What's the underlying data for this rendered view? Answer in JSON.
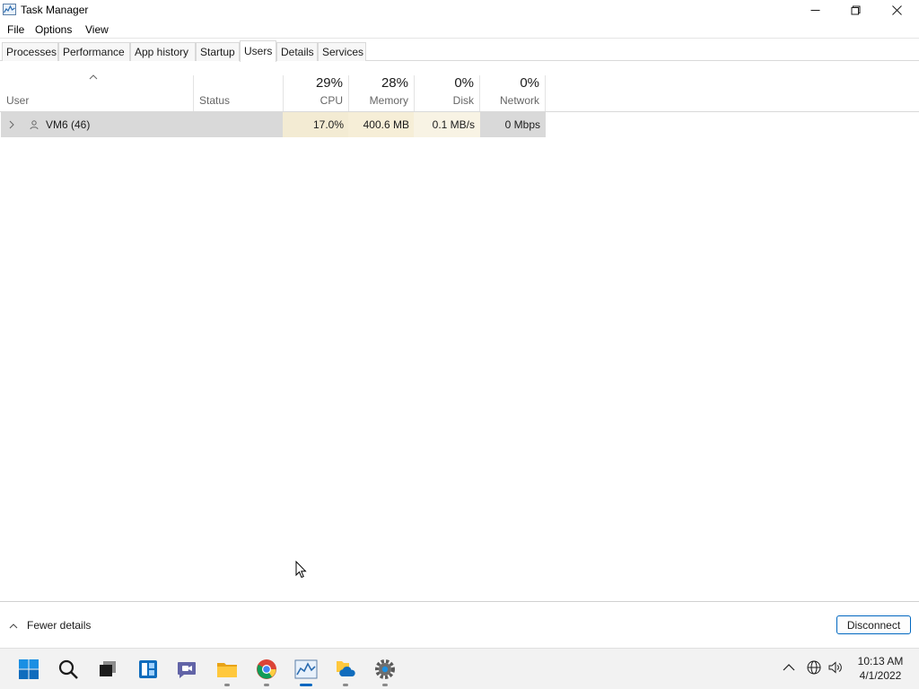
{
  "window": {
    "title": "Task Manager"
  },
  "menu": {
    "items": [
      "File",
      "Options",
      "View"
    ]
  },
  "tabs": [
    "Processes",
    "Performance",
    "App history",
    "Startup",
    "Users",
    "Details",
    "Services"
  ],
  "active_tab": "Users",
  "table": {
    "columns": {
      "user": {
        "label": "User"
      },
      "status": {
        "label": "Status"
      },
      "cpu": {
        "percent": "29%",
        "label": "CPU"
      },
      "memory": {
        "percent": "28%",
        "label": "Memory"
      },
      "disk": {
        "percent": "0%",
        "label": "Disk"
      },
      "network": {
        "percent": "0%",
        "label": "Network"
      }
    },
    "rows": [
      {
        "user": "VM6 (46)",
        "status": "",
        "cpu": "17.0%",
        "memory": "400.6 MB",
        "disk": "0.1 MB/s",
        "network": "0 Mbps"
      }
    ]
  },
  "footer": {
    "fewer_details": "Fewer details",
    "disconnect": "Disconnect"
  },
  "taskbar": {
    "apps": [
      "start-icon",
      "search-icon",
      "task-view-icon",
      "widgets-icon",
      "chat-icon",
      "file-explorer-icon",
      "chrome-icon",
      "task-manager-icon",
      "onedrive-folder-icon",
      "settings-icon"
    ],
    "clock_time": "10:13 AM",
    "clock_date": "4/1/2022"
  },
  "colors": {
    "accent": "#0067c0",
    "cpu_heat": "#f3ebd3",
    "memory_heat": "#f6eed7",
    "disk_heat": "#f8f3e4",
    "row_selected": "#d9d9d9"
  }
}
